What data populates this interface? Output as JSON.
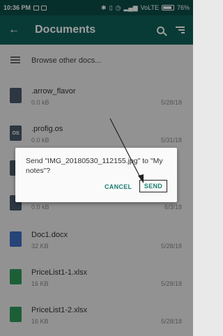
{
  "statusbar": {
    "time": "10:36 PM",
    "carrier": "VoLTE",
    "battery": "76%",
    "battery_level": 0.76
  },
  "appbar": {
    "title": "Documents"
  },
  "browse": {
    "label": "Browse other docs..."
  },
  "files": [
    {
      "name": ".arrow_flavor",
      "size": "0.0 kB",
      "date": "5/28/18",
      "icon": "doc-icon",
      "color": "#4a5a6a",
      "badge": ""
    },
    {
      "name": ".profig.os",
      "size": "0.0 kB",
      "date": "5/31/18",
      "icon": "os-file-icon",
      "color": "#4a5a6a",
      "badge": "OS"
    },
    {
      "name": "",
      "size": "",
      "date": "",
      "icon": "doc-icon",
      "color": "#4a5a6a",
      "badge": ""
    },
    {
      "name": "",
      "size": "0.0 kB",
      "date": "6/3/18",
      "icon": "doc-icon",
      "color": "#4a5a6a",
      "badge": ""
    },
    {
      "name": "Doc1.docx",
      "size": "32 KB",
      "date": "5/28/18",
      "icon": "word-doc-icon",
      "color": "#3f6fc4",
      "badge": ""
    },
    {
      "name": "PriceList1-1.xlsx",
      "size": "16 KB",
      "date": "5/28/18",
      "icon": "spreadsheet-icon",
      "color": "#2e9a5a",
      "badge": ""
    },
    {
      "name": "PriceList1-2.xlsx",
      "size": "16 KB",
      "date": "5/28/18",
      "icon": "spreadsheet-icon",
      "color": "#2e9a5a",
      "badge": ""
    }
  ],
  "dialog": {
    "message": "Send \"IMG_20180530_112155.jpg\" to \"My notes\"?",
    "cancel_label": "CANCEL",
    "send_label": "SEND"
  },
  "colors": {
    "statusbar": "#0b4d47",
    "appbar": "#0f5f58",
    "accent": "#1a7d73"
  }
}
